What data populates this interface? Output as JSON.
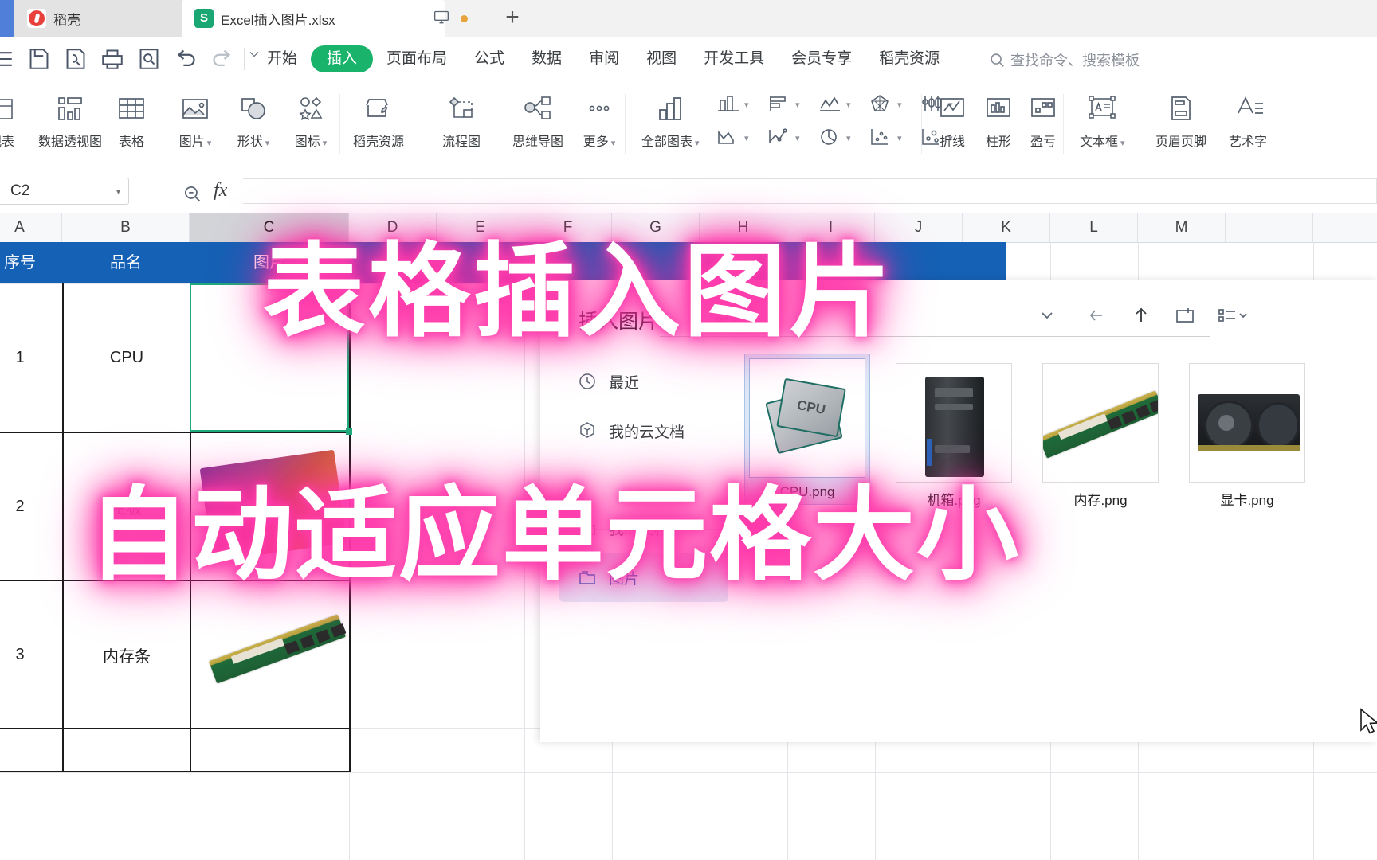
{
  "titlebar": {
    "tabs": [
      {
        "label": "稻壳",
        "icon": "docer-icon"
      },
      {
        "label": "Excel插入图片.xlsx",
        "icon": "xlsx-file-icon"
      }
    ],
    "monitor_icon": "monitor-icon",
    "modified_dot": "unsaved-dot",
    "new_tab": "+"
  },
  "quick_access": [
    {
      "name": "save-icon"
    },
    {
      "name": "save-as-icon"
    },
    {
      "name": "print-icon"
    },
    {
      "name": "print-preview-icon"
    },
    {
      "name": "undo-icon"
    },
    {
      "name": "redo-icon"
    },
    {
      "name": "customize-qat-icon"
    }
  ],
  "ribbon_tabs": [
    {
      "label": "开始",
      "active": false
    },
    {
      "label": "插入",
      "active": true
    },
    {
      "label": "页面布局",
      "active": false
    },
    {
      "label": "公式",
      "active": false
    },
    {
      "label": "数据",
      "active": false
    },
    {
      "label": "审阅",
      "active": false
    },
    {
      "label": "视图",
      "active": false
    },
    {
      "label": "开发工具",
      "active": false
    },
    {
      "label": "会员专享",
      "active": false
    },
    {
      "label": "稻壳资源",
      "active": false
    }
  ],
  "search": {
    "placeholder": "查找命令、搜索模板",
    "icon": "search-icon"
  },
  "ribbon_items": {
    "pivotchart": "数据透视图",
    "pivotchart_partial": "视表",
    "table": "表格",
    "picture": "图片",
    "shape": "形状",
    "icon": "图标",
    "docer_res": "稻壳资源",
    "flowchart": "流程图",
    "mindmap": "思维导图",
    "more": "更多",
    "all_charts": "全部图表",
    "line": "折线",
    "column": "柱形",
    "winloss": "盈亏",
    "textbox": "文本框",
    "headerfooter": "页眉页脚",
    "wordart": "艺术字"
  },
  "formula_bar": {
    "name_box_value": "C2",
    "fx_label": "fx",
    "formula_value": "",
    "zoom_icon": "zoom-out-icon"
  },
  "sheet": {
    "columns": [
      "A",
      "B",
      "C",
      "D",
      "E",
      "F",
      "G",
      "H",
      "I",
      "J",
      "K",
      "L",
      "M"
    ],
    "selected_column": "C",
    "table_headers": [
      "序号",
      "品名",
      "图片"
    ],
    "rows": [
      {
        "no": "1",
        "name": "CPU",
        "image": ""
      },
      {
        "no": "2",
        "name": "主板",
        "image": "motherboard"
      },
      {
        "no": "3",
        "name": "内存条",
        "image": "ram-stick"
      },
      {
        "no": "",
        "name": "",
        "image": ""
      }
    ],
    "active_cell": "C2"
  },
  "dialog": {
    "title": "插入图片",
    "path_text": "图片",
    "tools": [
      {
        "name": "chevron-down-icon",
        "glyph": "⌄"
      },
      {
        "name": "back-arrow-icon",
        "glyph": "←"
      },
      {
        "name": "up-arrow-icon",
        "glyph": "↑"
      },
      {
        "name": "new-folder-icon",
        "glyph": "◰"
      },
      {
        "name": "view-options-icon",
        "glyph": "☰"
      }
    ],
    "sidebar": [
      {
        "label": "最近",
        "icon": "clock-icon",
        "active": false
      },
      {
        "label": "我的云文档",
        "icon": "cloud-doc-icon",
        "active": false
      },
      {
        "label": "我的文档",
        "icon": "folder-icon",
        "active": false
      },
      {
        "label": "图片",
        "icon": "folder-icon",
        "active": true
      }
    ],
    "files": [
      {
        "name": "CPU.png",
        "thumb": "cpu",
        "selected": true
      },
      {
        "name": "机箱.png",
        "thumb": "tower",
        "selected": false
      },
      {
        "name": "内存.png",
        "thumb": "ram",
        "selected": false
      },
      {
        "name": "显卡.png",
        "thumb": "gpu",
        "selected": false
      }
    ]
  },
  "overlays": {
    "line1": "表格插入图片",
    "line2": "自动适应单元格大小",
    "color": "#ff2aa3"
  }
}
